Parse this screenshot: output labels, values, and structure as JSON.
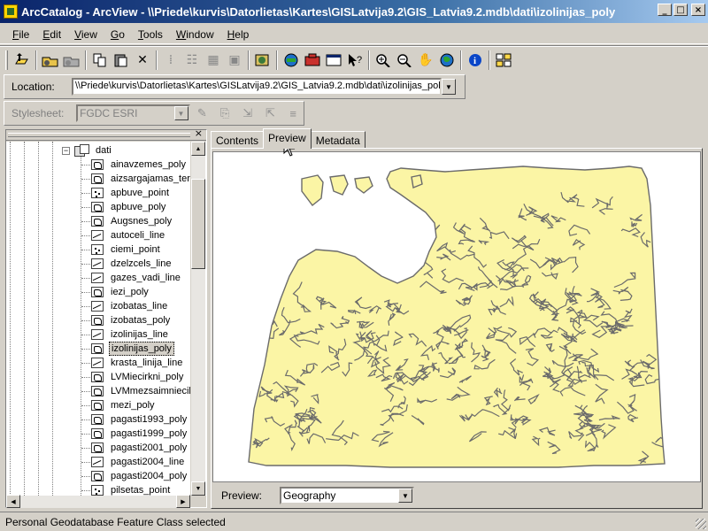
{
  "window": {
    "title": "ArcCatalog - ArcView - \\\\Priede\\kurvis\\Datorlietas\\Kartes\\GISLatvija9.2\\GIS_Latvia9.2.mdb\\dati\\izolinijas_poly"
  },
  "menu": [
    {
      "label": "File",
      "key": "F"
    },
    {
      "label": "Edit",
      "key": "E"
    },
    {
      "label": "View",
      "key": "V"
    },
    {
      "label": "Go",
      "key": "G"
    },
    {
      "label": "Tools",
      "key": "T"
    },
    {
      "label": "Window",
      "key": "W"
    },
    {
      "label": "Help",
      "key": "H"
    }
  ],
  "location": {
    "label": "Location:",
    "value": "\\\\Priede\\kurvis\\Datorlietas\\Kartes\\GISLatvija9.2\\GIS_Latvia9.2.mdb\\dati\\izolinijas_pol"
  },
  "stylesheet": {
    "label": "Stylesheet:",
    "value": "FGDC ESRI"
  },
  "tree": {
    "parent": "dati",
    "items": [
      {
        "label": "ainavzemes_poly",
        "type": "poly"
      },
      {
        "label": "aizsargajamas_ter",
        "type": "poly"
      },
      {
        "label": "apbuve_point",
        "type": "point"
      },
      {
        "label": "apbuve_poly",
        "type": "poly"
      },
      {
        "label": "Augsnes_poly",
        "type": "poly"
      },
      {
        "label": "autoceli_line",
        "type": "line"
      },
      {
        "label": "ciemi_point",
        "type": "point"
      },
      {
        "label": "dzelzcels_line",
        "type": "line"
      },
      {
        "label": "gazes_vadi_line",
        "type": "line"
      },
      {
        "label": "iezi_poly",
        "type": "poly"
      },
      {
        "label": "izobatas_line",
        "type": "line"
      },
      {
        "label": "izobatas_poly",
        "type": "poly"
      },
      {
        "label": "izolinijas_line",
        "type": "line"
      },
      {
        "label": "izolinijas_poly",
        "type": "poly",
        "selected": true
      },
      {
        "label": "krasta_linija_line",
        "type": "line"
      },
      {
        "label": "LVMiecirkni_poly",
        "type": "poly"
      },
      {
        "label": "LVMmezsaimnieciba",
        "type": "poly"
      },
      {
        "label": "mezi_poly",
        "type": "poly"
      },
      {
        "label": "pagasti1993_poly",
        "type": "poly"
      },
      {
        "label": "pagasti1999_poly",
        "type": "poly"
      },
      {
        "label": "pagasti2001_poly",
        "type": "poly"
      },
      {
        "label": "pagasti2004_line",
        "type": "line"
      },
      {
        "label": "pagasti2004_poly",
        "type": "poly"
      },
      {
        "label": "pilsetas_point",
        "type": "point"
      }
    ]
  },
  "tabs": [
    {
      "label": "Contents",
      "active": false
    },
    {
      "label": "Preview",
      "active": true
    },
    {
      "label": "Metadata",
      "active": false
    }
  ],
  "preview": {
    "label": "Preview:",
    "mode": "Geography",
    "fill_color": "#fbf5a5",
    "stroke_color": "#6b6b6b"
  },
  "status": {
    "text": "Personal Geodatabase Feature Class selected"
  },
  "toolbar_icons": [
    "up-one-level-icon",
    "connect-folder-icon",
    "disconnect-folder-icon",
    "copy-icon",
    "paste-icon",
    "delete-icon",
    "large-icons-icon",
    "list-icon",
    "details-icon",
    "thumbnails-icon",
    "launch-arcmap-icon",
    "arctoolbox-icon",
    "catalog-tree-icon",
    "command-line-icon",
    "whats-this-icon",
    "zoom-in-icon",
    "zoom-out-icon",
    "pan-icon",
    "full-extent-icon",
    "identify-icon",
    "create-thumbnail-icon"
  ]
}
